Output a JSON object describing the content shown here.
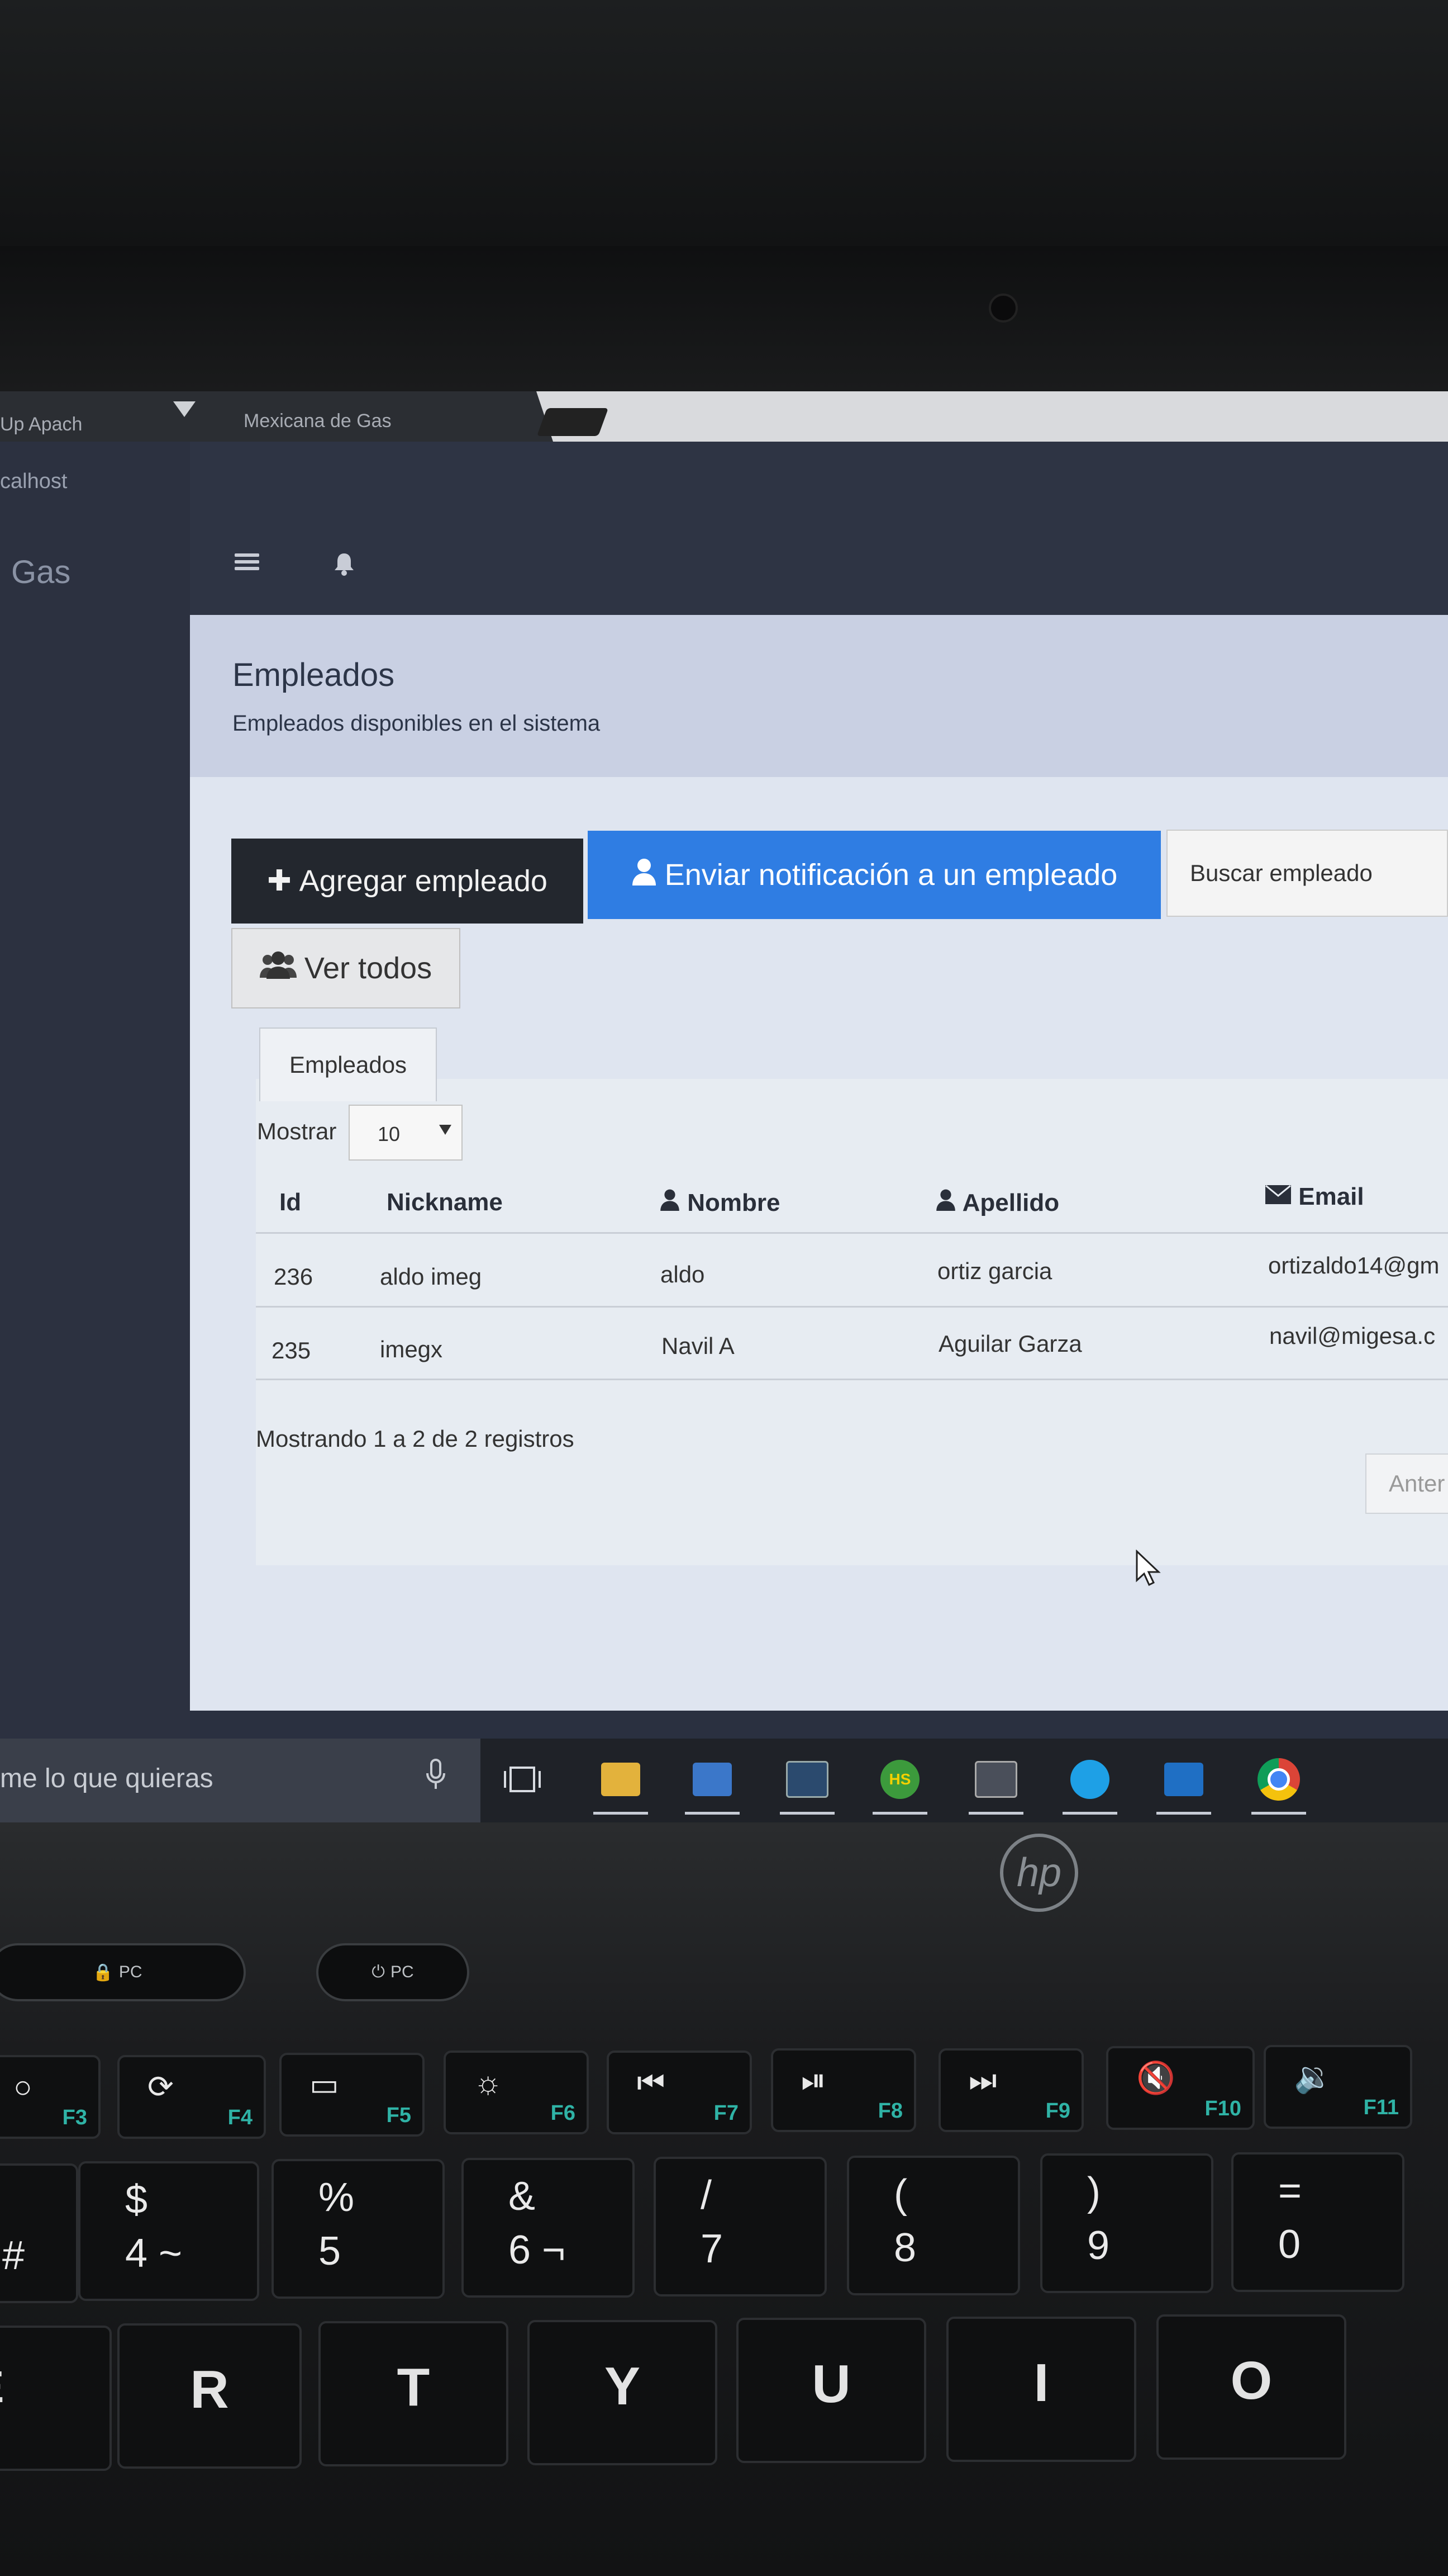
{
  "browser": {
    "tab_partial_1": "Up Apach",
    "tab_partial_2": "calhost",
    "tab_title": "Mexicana de Gas"
  },
  "sidebar": {
    "brand_partial": "Gas"
  },
  "page": {
    "title": "Empleados",
    "subtitle": "Empleados disponibles en el sistema"
  },
  "toolbar": {
    "add_label": "Agregar empleado",
    "notify_label": "Enviar notificación a un empleado",
    "search_placeholder": "Buscar empleado",
    "all_label": "Ver todos"
  },
  "panel": {
    "tab_label": "Empleados",
    "length_label": "Mostrar",
    "length_value": "10",
    "columns": [
      "Id",
      "Nickname",
      "Nombre",
      "Apellido",
      "Email"
    ],
    "rows": [
      {
        "id": "236",
        "nickname": "aldo imeg",
        "nombre": "aldo",
        "apellido": "ortiz garcia",
        "email": "ortizaldo14@gm"
      },
      {
        "id": "235",
        "nickname": "imegx",
        "nombre": "Navil A",
        "apellido": "Aguilar Garza",
        "email": "navil@migesa.c"
      }
    ],
    "info": "Mostrando 1 a 2 de 2 registros",
    "prev_label": "Anter"
  },
  "taskbar": {
    "search_text": "me lo que quieras",
    "hs_label": "HS"
  },
  "keyboard": {
    "hp_logo": "hp",
    "pc1": "PC",
    "pc2": "PC",
    "fkeys": [
      "F3",
      "F4",
      "F5",
      "F6",
      "F7",
      "F8",
      "F9",
      "F10",
      "F11"
    ],
    "numrow": [
      {
        "top": "",
        "bot": "#"
      },
      {
        "top": "$",
        "bot": "4 ~"
      },
      {
        "top": "%",
        "bot": "5"
      },
      {
        "top": "&",
        "bot": "6 ¬"
      },
      {
        "top": "/",
        "bot": "7"
      },
      {
        "top": "(",
        "bot": "8"
      },
      {
        "top": ")",
        "bot": "9"
      },
      {
        "top": "=",
        "bot": "0"
      }
    ],
    "letters": [
      "E",
      "R",
      "T",
      "Y",
      "U",
      "I",
      "O"
    ],
    "euro": "€"
  },
  "colors": {
    "primary_button": "#2f7de3",
    "dark_button": "#23272e",
    "fn_accent": "#2fb3a6"
  }
}
